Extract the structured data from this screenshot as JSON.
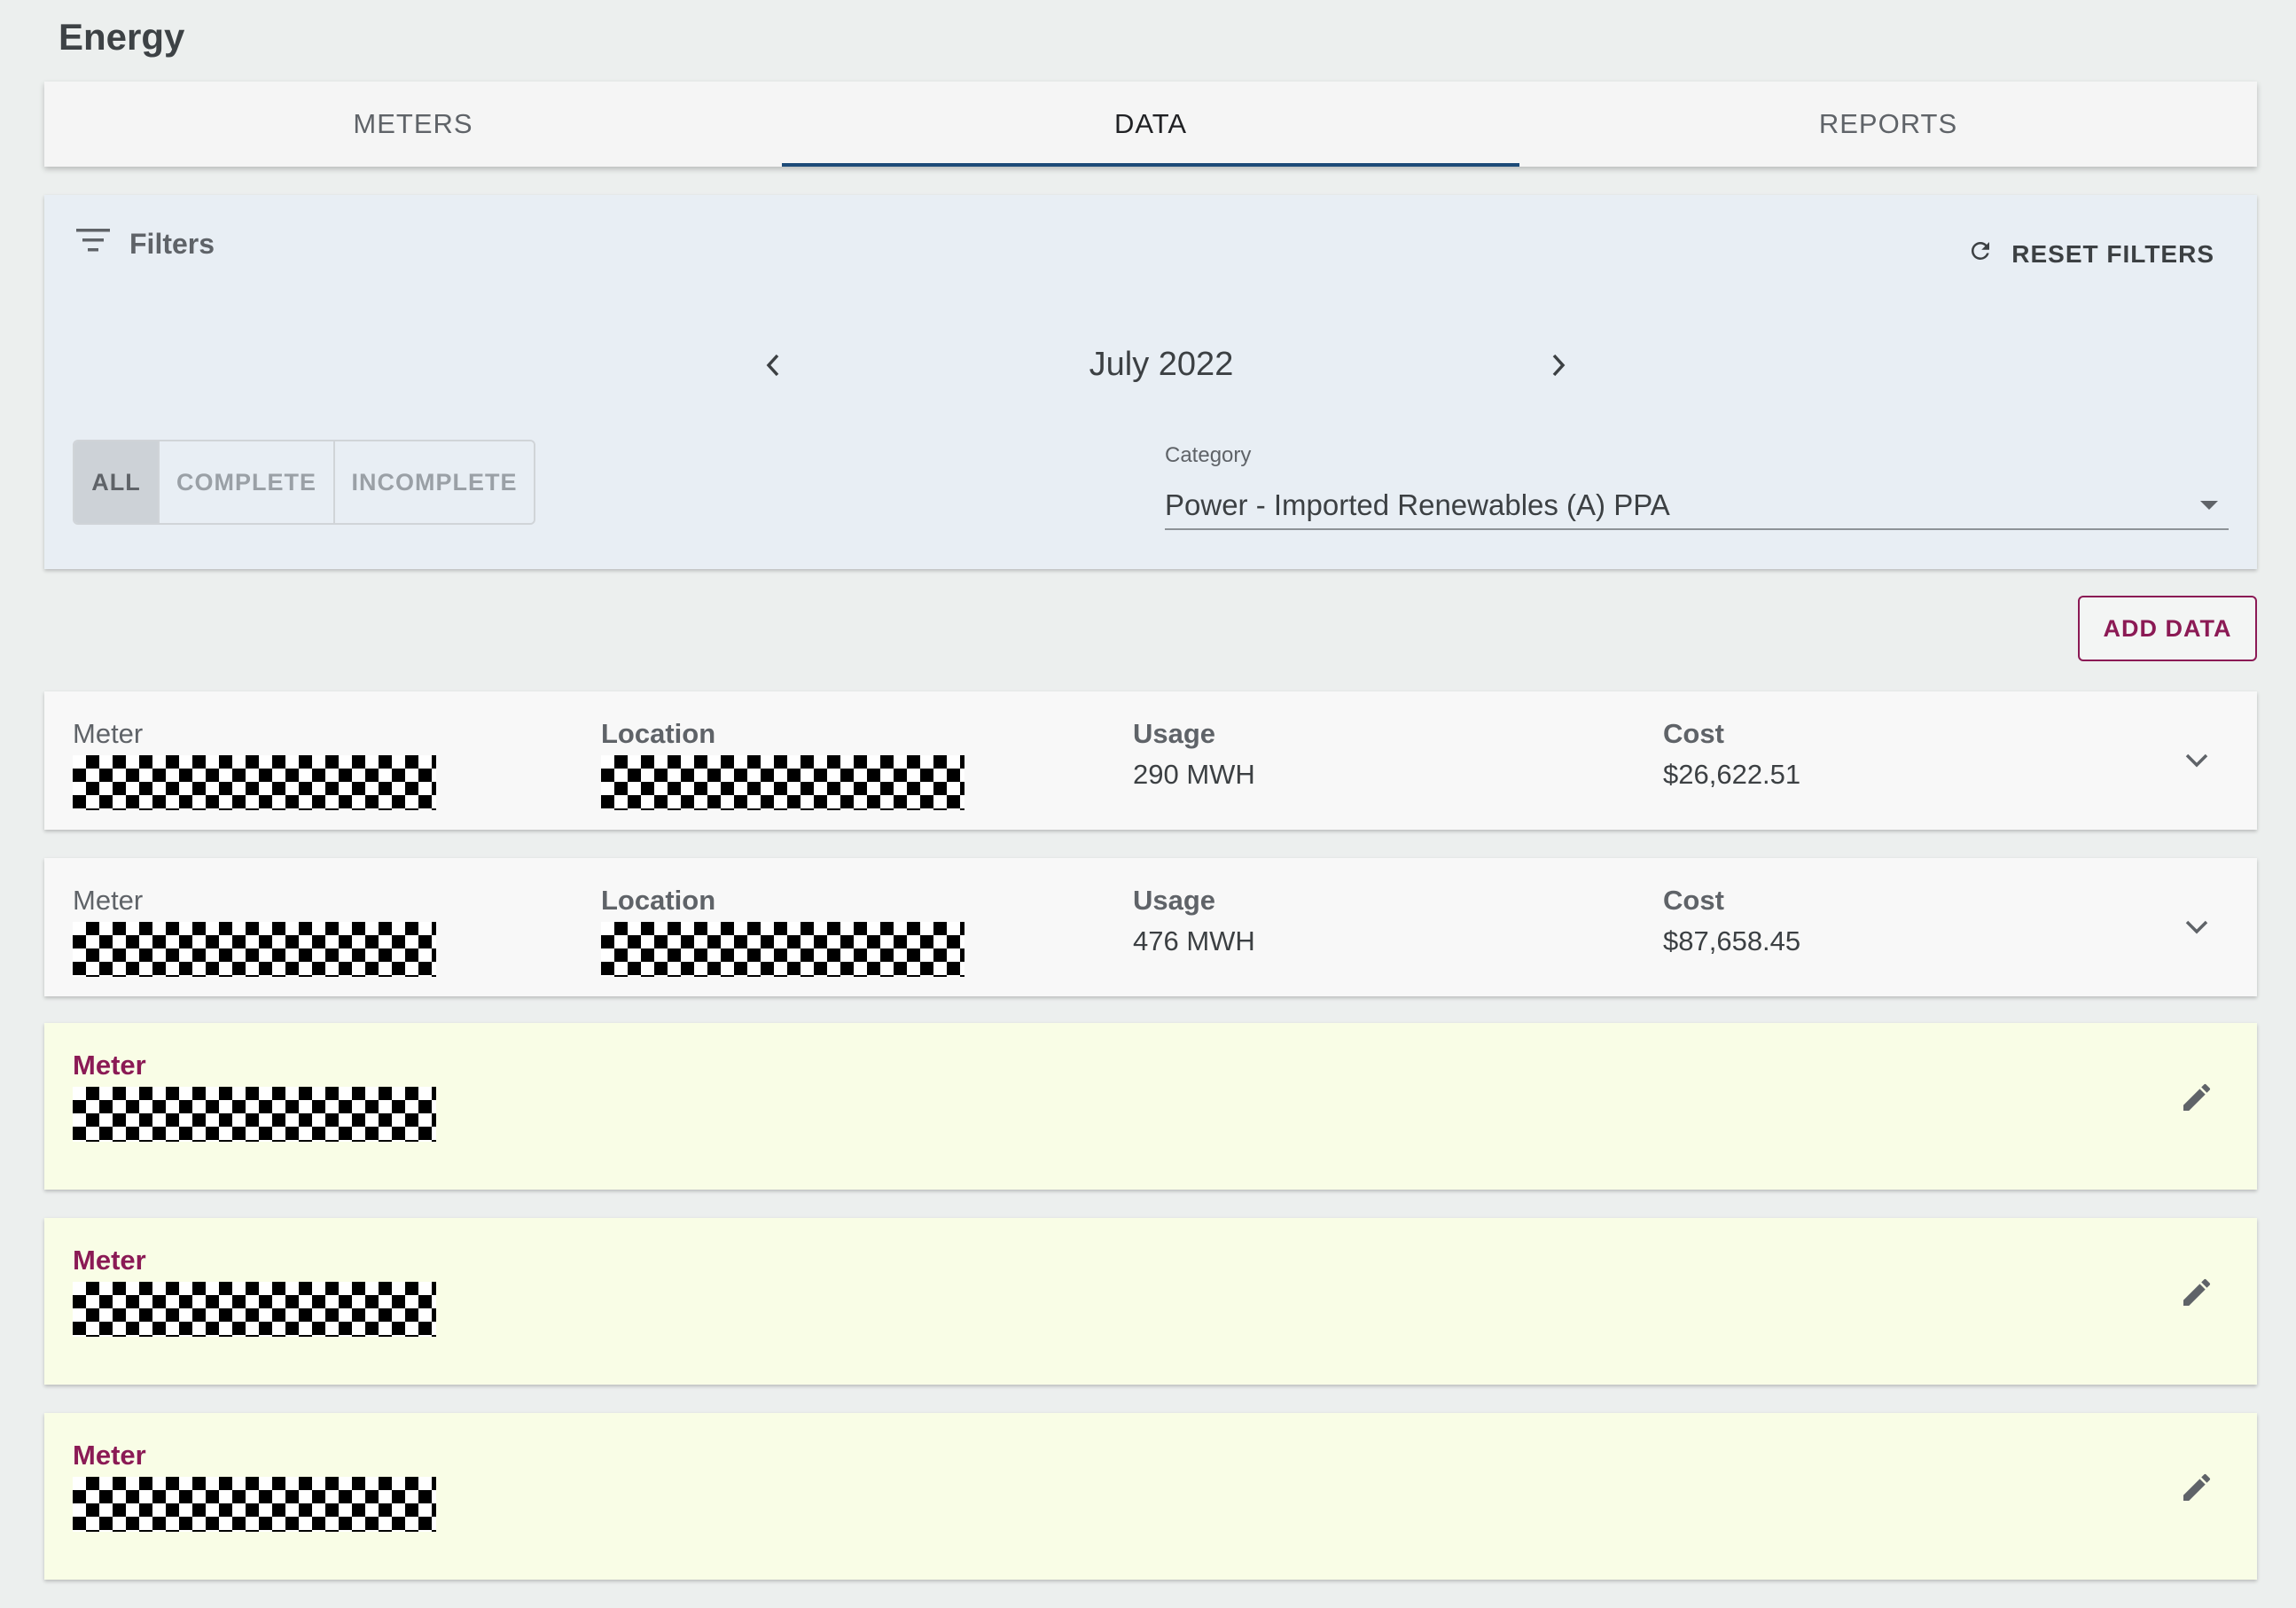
{
  "page": {
    "title": "Energy"
  },
  "tabs": [
    {
      "label": "METERS",
      "active": false
    },
    {
      "label": "DATA",
      "active": true
    },
    {
      "label": "REPORTS",
      "active": false
    }
  ],
  "filters": {
    "title": "Filters",
    "reset_label": "RESET FILTERS",
    "month": "July 2022",
    "status_options": [
      "ALL",
      "COMPLETE",
      "INCOMPLETE"
    ],
    "selected_status": "ALL",
    "category_label": "Category",
    "category_value": "Power - Imported Renewables (A) PPA"
  },
  "actions": {
    "add_data_label": "ADD DATA"
  },
  "complete_rows": [
    {
      "meter_label": "Meter",
      "location_label": "Location",
      "usage_label": "Usage",
      "usage": "290 MWH",
      "cost_label": "Cost",
      "cost": "$26,622.51"
    },
    {
      "meter_label": "Meter",
      "location_label": "Location",
      "usage_label": "Usage",
      "usage": "476 MWH",
      "cost_label": "Cost",
      "cost": "$87,658.45"
    }
  ],
  "incomplete_rows": [
    {
      "meter_label": "Meter"
    },
    {
      "meter_label": "Meter"
    },
    {
      "meter_label": "Meter"
    }
  ],
  "colors": {
    "accent": "#8b1a55",
    "tab_indicator": "#1d4b78",
    "incomplete_bg": "#f9fde6",
    "filter_bg": "#e8eef4"
  },
  "icons": {
    "filter": "filter-list-icon",
    "reset": "refresh-icon",
    "prev": "chevron-left-icon",
    "next": "chevron-right-icon",
    "expand": "chevron-down-icon",
    "edit": "pencil-icon"
  }
}
